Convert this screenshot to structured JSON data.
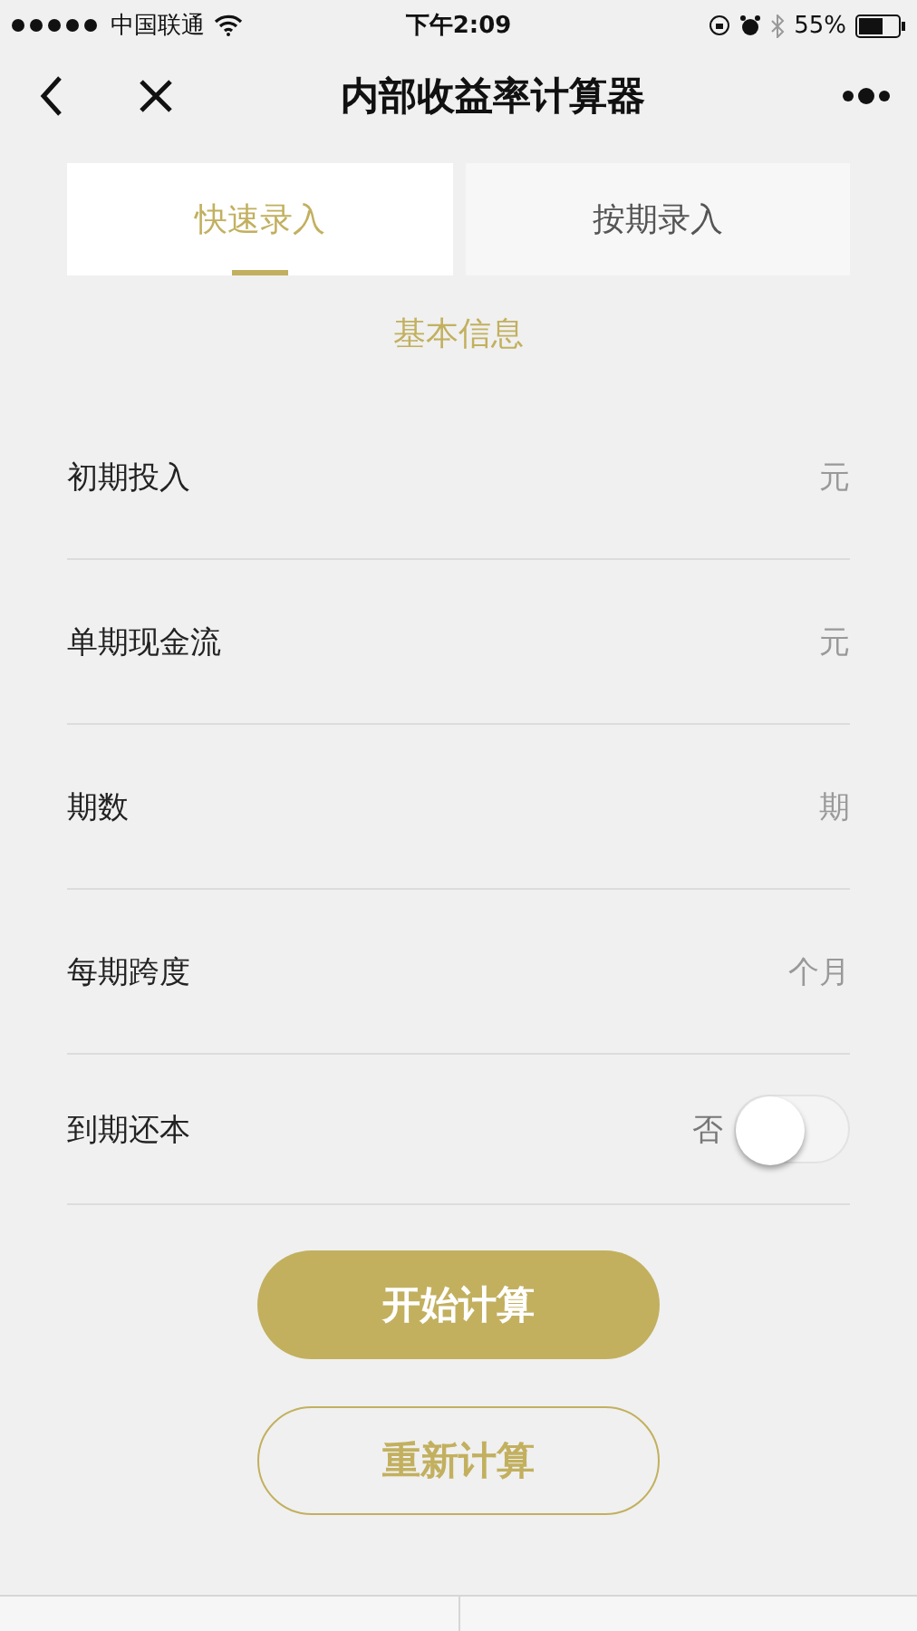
{
  "status_bar": {
    "carrier": "中国联通",
    "time": "下午2:09",
    "battery": "55%"
  },
  "nav": {
    "title": "内部收益率计算器"
  },
  "tabs": [
    {
      "label": "快速录入",
      "selected": true
    },
    {
      "label": "按期录入",
      "selected": false
    }
  ],
  "section_title": "基本信息",
  "fields": [
    {
      "kind": "input",
      "label": "初期投入",
      "unit": "元"
    },
    {
      "kind": "input",
      "label": "单期现金流",
      "unit": "元"
    },
    {
      "kind": "input",
      "label": "期数",
      "unit": "期"
    },
    {
      "kind": "input",
      "label": "每期跨度",
      "unit": "个月"
    },
    {
      "kind": "toggle",
      "label": "到期还本",
      "state_text": "否",
      "on": false
    }
  ],
  "buttons": [
    {
      "kind": "primary",
      "label": "开始计算"
    },
    {
      "kind": "outline",
      "label": "重新计算"
    }
  ]
}
